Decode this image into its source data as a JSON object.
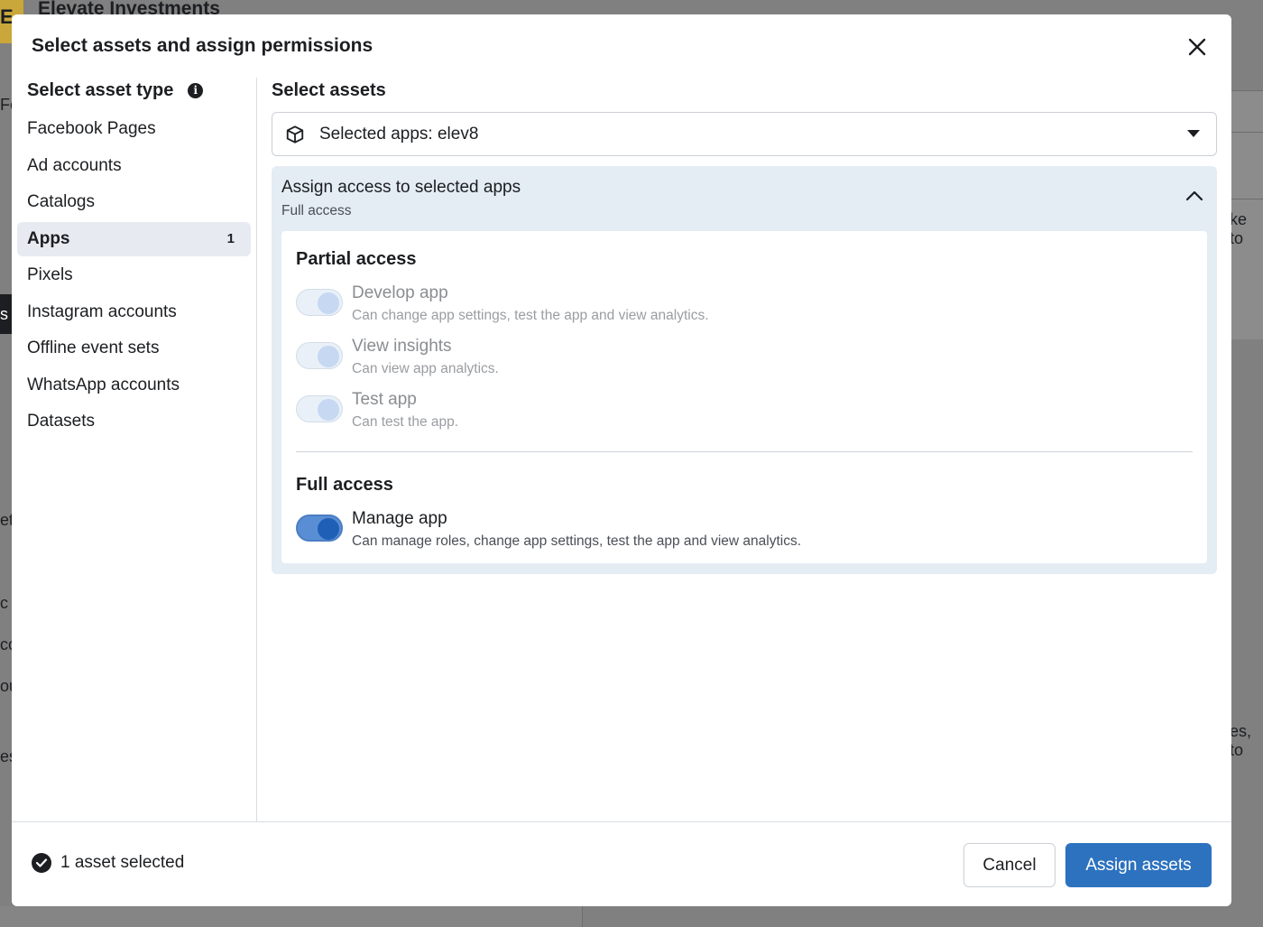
{
  "background": {
    "page_title": "Elevate Investments",
    "logo_letter": "E",
    "fragments": [
      "Fo",
      "s",
      "ke to",
      "et",
      "c",
      "co",
      "ou",
      "es",
      "es, to"
    ]
  },
  "modal": {
    "title": "Select assets and assign permissions"
  },
  "asset_types": {
    "heading": "Select asset type",
    "items": [
      {
        "label": "Facebook Pages",
        "count": ""
      },
      {
        "label": "Ad accounts",
        "count": ""
      },
      {
        "label": "Catalogs",
        "count": ""
      },
      {
        "label": "Apps",
        "count": "1"
      },
      {
        "label": "Pixels",
        "count": ""
      },
      {
        "label": "Instagram accounts",
        "count": ""
      },
      {
        "label": "Offline event sets",
        "count": ""
      },
      {
        "label": "WhatsApp accounts",
        "count": ""
      },
      {
        "label": "Datasets",
        "count": ""
      }
    ],
    "active_index": 3
  },
  "assets": {
    "heading": "Select assets",
    "selected_text": "Selected apps: elev8"
  },
  "access": {
    "title": "Assign access to selected apps",
    "summary": "Full access",
    "partial": {
      "title": "Partial access",
      "permissions": [
        {
          "label": "Develop app",
          "description": "Can change app settings, test the app and view analytics.",
          "state": "on-disabled"
        },
        {
          "label": "View insights",
          "description": "Can view app analytics.",
          "state": "on-disabled"
        },
        {
          "label": "Test app",
          "description": "Can test the app.",
          "state": "on-disabled"
        }
      ]
    },
    "full": {
      "title": "Full access",
      "permissions": [
        {
          "label": "Manage app",
          "description": "Can manage roles, change app settings, test the app and view analytics.",
          "state": "on"
        }
      ]
    }
  },
  "footer": {
    "status": "1 asset selected",
    "cancel_label": "Cancel",
    "assign_label": "Assign assets"
  },
  "colors": {
    "primary": "#2d72bf",
    "panel": "#e4ecf4",
    "active_item": "#e7ebf1"
  }
}
